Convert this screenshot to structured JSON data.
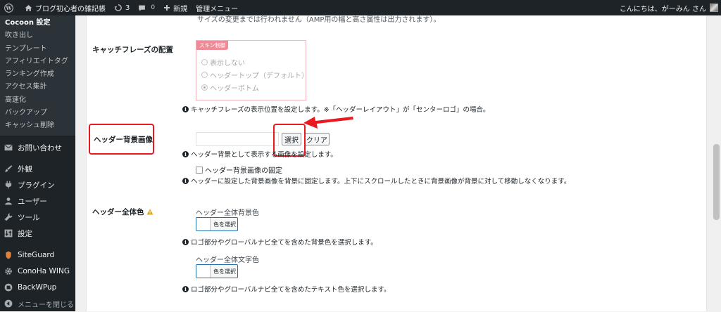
{
  "adminbar": {
    "site_name": "ブログ初心者の雑記帳",
    "updates_count": "3",
    "comments_count": "0",
    "new_label": "新規",
    "manage_menu": "管理メニュー",
    "greeting": "こんにちは、がーみん さん"
  },
  "sidebar": {
    "submenu": [
      "Cocoon 設定",
      "吹き出し",
      "テンプレート",
      "アフィリエイトタグ",
      "ランキング作成",
      "アクセス集計",
      "高速化",
      "バックアップ",
      "キャッシュ削除"
    ],
    "menu": [
      {
        "label": "お問い合わせ",
        "icon": "mail-icon"
      },
      {
        "label": "外観",
        "icon": "brush-icon"
      },
      {
        "label": "プラグイン",
        "icon": "plugin-icon"
      },
      {
        "label": "ユーザー",
        "icon": "user-icon"
      },
      {
        "label": "ツール",
        "icon": "wrench-icon"
      },
      {
        "label": "設定",
        "icon": "settings-icon"
      },
      {
        "label": "SiteGuard",
        "icon": "siteguard-icon"
      },
      {
        "label": "ConoHa WING",
        "icon": "gear-icon"
      },
      {
        "label": "BackWPup",
        "icon": "backwpup-icon"
      }
    ],
    "collapse_label": "メニューを閉じる"
  },
  "content": {
    "top_note": "サイズの変更までは行われません（AMP用の幅と高さ属性は出力されます）。",
    "catchphrase": {
      "label": "キャッチフレーズの配置",
      "skin_tag": "スキン制御",
      "options": [
        "表示しない",
        "ヘッダートップ（デフォルト）",
        "ヘッダーボトム"
      ],
      "selected_index": 2,
      "description": "キャッチフレーズの表示位置を設定します。※「ヘッダーレイアウト」が「センターロゴ」の場合。"
    },
    "header_bg": {
      "label": "ヘッダー背景画像",
      "input_value": "",
      "select_label": "選択",
      "clear_label": "クリア",
      "description": "ヘッダー背景として表示する画像を設定します。",
      "fixed_label": "ヘッダー背景画像の固定",
      "fixed_description": "ヘッダーに設定した背景画像を背景に固定します。上下にスクロールしたときに背景画像が背景に対して移動しなくなります。"
    },
    "header_color": {
      "label": "ヘッダー全体色",
      "bg_label": "ヘッダー全体背景色",
      "color_button_label": "色を選択",
      "bg_description": "ロゴ部分やグローバルナビ全てを含めた背景色を選択します。",
      "text_label": "ヘッダー全体文字色",
      "text_description": "ロゴ部分やグローバルナビ全てを含めたテキスト色を選択します。"
    }
  },
  "colors": {
    "admin_dark": "#1d2327",
    "highlight_red": "#e9191f",
    "skin_border": "#f4b6bd",
    "warning": "#dba617"
  }
}
